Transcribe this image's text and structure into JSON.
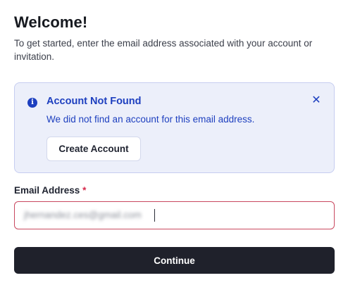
{
  "header": {
    "title": "Welcome!",
    "subtitle": "To get started, enter the email address associated with your account or invitation."
  },
  "alert": {
    "icon": "info-circle-icon",
    "title": "Account Not Found",
    "message": "We did not find an account for this email address.",
    "close_icon": "close-icon",
    "close_glyph": "✕",
    "info_glyph": "i",
    "button_label": "Create Account"
  },
  "form": {
    "email_label": "Email Address",
    "required_mark": "*",
    "email_value": "jhernandez.ces@gmail.com"
  },
  "actions": {
    "continue_label": "Continue"
  },
  "colors": {
    "accent": "#1d3fbf",
    "alert_bg": "#eceffa",
    "error": "#c9485f",
    "primary_button": "#1f212b"
  }
}
